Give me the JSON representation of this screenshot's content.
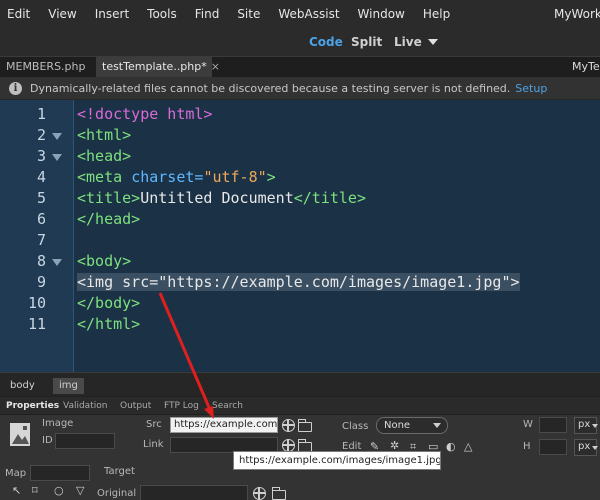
{
  "menubar": {
    "items": [
      "Edit",
      "View",
      "Insert",
      "Tools",
      "Find",
      "Site",
      "WebAssist",
      "Window",
      "Help"
    ],
    "workspace": "MyWorks"
  },
  "views": {
    "code": "Code",
    "split": "Split",
    "live": "Live"
  },
  "tabs": [
    {
      "label": "MEMBERS.php",
      "active": false,
      "close": ""
    },
    {
      "label": "testTemplate..php*",
      "active": true,
      "close": "×"
    }
  ],
  "tab_right": "MyTes",
  "infobar": {
    "message": "Dynamically-related files cannot be discovered because a testing server is not defined.",
    "link": "Setup"
  },
  "editor": {
    "line_numbers": [
      "1",
      "2",
      "3",
      "4",
      "5",
      "6",
      "7",
      "8",
      "9",
      "10",
      "11"
    ],
    "folds": [
      false,
      true,
      true,
      false,
      false,
      false,
      false,
      true,
      false,
      false,
      false
    ],
    "highlighted_line": 9,
    "lines": [
      [
        {
          "t": "<!doctype html>",
          "c": "doctype"
        }
      ],
      [
        {
          "t": "<html>",
          "c": "tag"
        }
      ],
      [
        {
          "t": "<head>",
          "c": "tag"
        }
      ],
      [
        {
          "t": "<meta ",
          "c": "tag"
        },
        {
          "t": "charset=",
          "c": "attr"
        },
        {
          "t": "\"utf-8\"",
          "c": "str"
        },
        {
          "t": ">",
          "c": "tag"
        }
      ],
      [
        {
          "t": "<title>",
          "c": "tag"
        },
        {
          "t": "Untitled Document",
          "c": "text"
        },
        {
          "t": "</title>",
          "c": "tag"
        }
      ],
      [
        {
          "t": "</head>",
          "c": "tag"
        }
      ],
      [],
      [
        {
          "t": "<body>",
          "c": "tag"
        }
      ],
      [
        {
          "t": "<img src=\"https://example.com/images/image1.jpg\">",
          "c": "text"
        }
      ],
      [
        {
          "t": "</body>",
          "c": "tag"
        }
      ],
      [
        {
          "t": "</html>",
          "c": "tag"
        }
      ]
    ]
  },
  "tagbar": {
    "items": [
      "body",
      "img"
    ],
    "selected": "img"
  },
  "panel": {
    "tabs": [
      "Properties",
      "Validation",
      "Output",
      "FTP Log",
      "Search"
    ],
    "image_label": "Image",
    "id_label": "ID",
    "src_label": "Src",
    "src_value": "https://example.com/images/image1.jpg",
    "link_label": "Link",
    "class_label": "Class",
    "class_value": "None",
    "edit_label": "Edit",
    "w_label": "W",
    "h_label": "H",
    "unit": "px",
    "map_label": "Map",
    "target_label": "Target",
    "original_label": "Original"
  },
  "tooltip": "https://example.com/images/image1.jpg",
  "colors": {
    "accent": "#4aa3e8",
    "arrow": "#e01f1f",
    "editor_bg": "#1a3146"
  }
}
